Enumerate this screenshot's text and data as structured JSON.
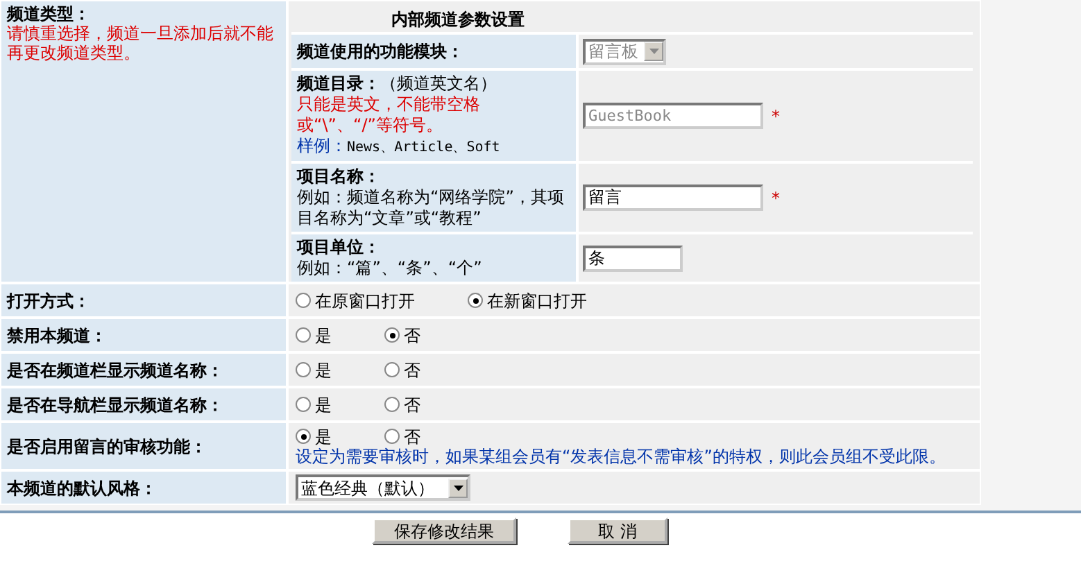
{
  "channel_type": {
    "label": "频道类型：",
    "note": "请慎重选择，频道一旦添加后就不能再更改频道类型。"
  },
  "internal_params": {
    "title": "内部频道参数设置",
    "rows": [
      {
        "kind": "select",
        "label": "频道使用的功能模块：",
        "value": "留言板",
        "disabled": true
      },
      {
        "kind": "text",
        "label": "频道目录：",
        "label_note": "（频道英文名）",
        "warning": "只能是英文，不能带空格或“\\”、“/”等符号。",
        "example_label": "样例：",
        "example_text": "News、Article、Soft",
        "value": "GuestBook",
        "disabled": true,
        "required_mark": "*"
      },
      {
        "kind": "text",
        "label": "项目名称：",
        "hint": "例如：频道名称为“网络学院”，其项目名称为“文章”或“教程”",
        "value": "留言",
        "disabled": false,
        "required_mark": "*"
      },
      {
        "kind": "short_text",
        "label": "项目单位：",
        "hint": "例如：“篇”、“条”、“个”",
        "value": "条",
        "disabled": false
      }
    ]
  },
  "settings": [
    {
      "kind": "radio",
      "label": "打开方式：",
      "options": [
        {
          "label": "在原窗口打开",
          "selected": false
        },
        {
          "label": "在新窗口打开",
          "selected": true
        }
      ]
    },
    {
      "kind": "radio",
      "label": "禁用本频道：",
      "options": [
        {
          "label": "是",
          "selected": false
        },
        {
          "label": "否",
          "selected": true
        }
      ]
    },
    {
      "kind": "radio",
      "label": "是否在频道栏显示频道名称：",
      "options": [
        {
          "label": "是",
          "selected": false
        },
        {
          "label": "否",
          "selected": false
        }
      ]
    },
    {
      "kind": "radio",
      "label": "是否在导航栏显示频道名称：",
      "options": [
        {
          "label": "是",
          "selected": false
        },
        {
          "label": "否",
          "selected": false
        }
      ]
    },
    {
      "kind": "radio",
      "label": "是否启用留言的审核功能：",
      "options": [
        {
          "label": "是",
          "selected": true
        },
        {
          "label": "否",
          "selected": false
        }
      ],
      "note": "设定为需要审核时，如果某组会员有“发表信息不需审核”的特权，则此会员组不受此限。"
    },
    {
      "kind": "select",
      "label": "本频道的默认风格：",
      "value": "蓝色经典（默认）"
    }
  ],
  "buttons": [
    {
      "label": "保存修改结果"
    },
    {
      "label": "取 消"
    }
  ]
}
